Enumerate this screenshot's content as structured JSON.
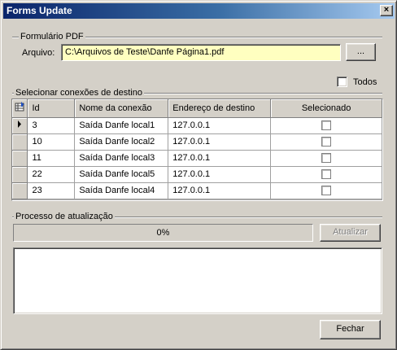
{
  "window": {
    "title": "Forms Update",
    "close_glyph": "×"
  },
  "form_group": {
    "title": "Formulário PDF",
    "file_label": "Arquivo:",
    "file_value": "C:\\Arquivos de Teste\\Danfe Página1.pdf",
    "browse_label": "..."
  },
  "connections_group": {
    "title": "Selecionar conexões de destino",
    "all_label": "Todos",
    "all_checked": false,
    "columns": [
      "Id",
      "Nome da conexão",
      "Endereço de destino",
      "Selecionado"
    ],
    "rows": [
      {
        "id": "3",
        "name": "Saída Danfe local1",
        "address": "127.0.0.1",
        "selected": false,
        "current": true
      },
      {
        "id": "10",
        "name": "Saída Danfe local2",
        "address": "127.0.0.1",
        "selected": false,
        "current": false
      },
      {
        "id": "11",
        "name": "Saída Danfe local3",
        "address": "127.0.0.1",
        "selected": false,
        "current": false
      },
      {
        "id": "22",
        "name": "Saída Danfe local5",
        "address": "127.0.0.1",
        "selected": false,
        "current": false
      },
      {
        "id": "23",
        "name": "Saída Danfe local4",
        "address": "127.0.0.1",
        "selected": false,
        "current": false
      }
    ]
  },
  "update_group": {
    "title": "Processo de atualização",
    "progress": 0,
    "progress_text": "0%",
    "update_label": "Atualizar",
    "update_enabled": false,
    "log_text": ""
  },
  "footer": {
    "close_label": "Fechar"
  },
  "icons": {
    "grid_corner": "grid-options-icon",
    "current_row": "row-pointer-icon"
  }
}
